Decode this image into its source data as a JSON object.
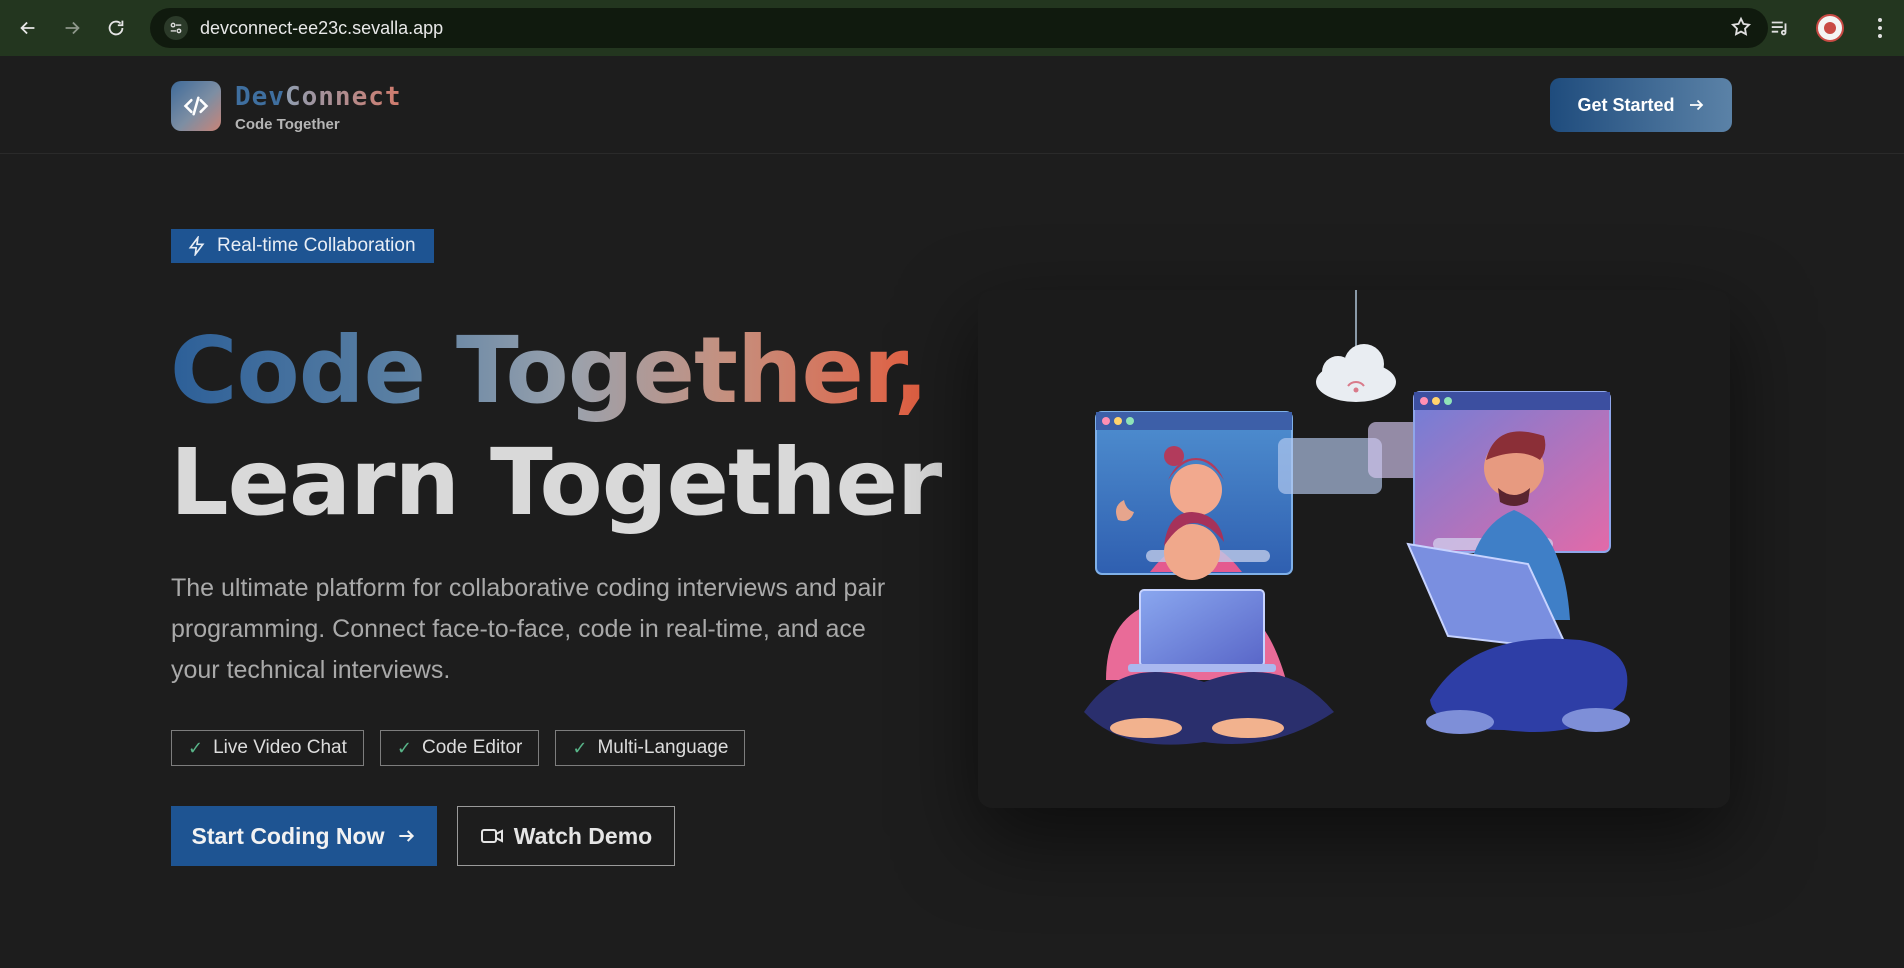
{
  "browser": {
    "url": "devconnect-ee23c.sevalla.app"
  },
  "header": {
    "brand_dev": "Dev",
    "brand_connect": "Connect",
    "tagline": "Code Together",
    "cta_label": "Get Started"
  },
  "hero": {
    "badge": "Real-time Collaboration",
    "title_line1": "Code Together,",
    "title_line2": "Learn Together",
    "description": "The ultimate platform for collaborative coding interviews and pair programming. Connect face-to-face, code in real-time, and ace your technical interviews.",
    "features": [
      "Live Video Chat",
      "Code Editor",
      "Multi-Language"
    ],
    "primary_cta": "Start Coding Now",
    "secondary_cta": "Watch Demo"
  },
  "colors": {
    "accent": "#1e5492",
    "background": "#1d1d1d",
    "gradient_end": "#e45a3b",
    "check": "#58b488"
  },
  "icons": {
    "badge": "lightning-icon",
    "features": "check-icon",
    "demo": "video-camera-icon",
    "arrow": "arrow-right-icon"
  }
}
